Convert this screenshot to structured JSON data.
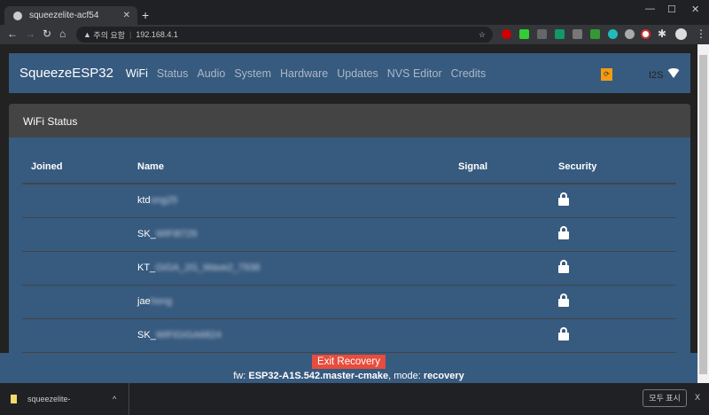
{
  "browser": {
    "tab_title": "squeezelite-acf54",
    "security_label": "주의 요함",
    "url": "192.168.4.1",
    "extensions": [
      "adblock-plus",
      "green",
      "c",
      "android",
      "i",
      "crop",
      "dns",
      "compass",
      "record",
      "puzzle",
      "profile"
    ]
  },
  "navbar": {
    "brand": "SqueezeESP32",
    "items": [
      "WiFi",
      "Status",
      "Audio",
      "System",
      "Hardware",
      "Updates",
      "NVS Editor",
      "Credits"
    ],
    "active": "WiFi",
    "recovery_icon_color": "#f39c12",
    "output_label": "I2S"
  },
  "card": {
    "title": "WiFi Status",
    "columns": [
      "Joined",
      "Name",
      "Signal",
      "Security"
    ],
    "rows": [
      {
        "joined": "",
        "name_visible": "ktd",
        "name_blurred": "ong25",
        "signal": "",
        "security": "lock-icon"
      },
      {
        "joined": "",
        "name_visible": "SK_",
        "name_blurred": "WiFi8729",
        "signal": "",
        "security": "lock-icon"
      },
      {
        "joined": "",
        "name_visible": "KT_",
        "name_blurred": "GiGA_2G_Wave2_7938",
        "signal": "",
        "security": "lock-icon"
      },
      {
        "joined": "",
        "name_visible": "jae",
        "name_blurred": "hong",
        "signal": "",
        "security": "lock-icon"
      },
      {
        "joined": "",
        "name_visible": "SK_",
        "name_blurred": "WiFiGIGA6824",
        "signal": "",
        "security": "lock-icon"
      }
    ]
  },
  "footer": {
    "exit_label": "Exit Recovery",
    "fw_prefix": "fw: ",
    "fw_value": "ESP32-A1S.542.master-cmake",
    "mode_prefix": ", mode: ",
    "mode_value": "recovery"
  },
  "downloads": {
    "file": "squeezelite-",
    "show_all": "모두 표시"
  },
  "colors": {
    "primary": "#375a7f",
    "danger": "#e74c3c",
    "header": "#444444"
  }
}
